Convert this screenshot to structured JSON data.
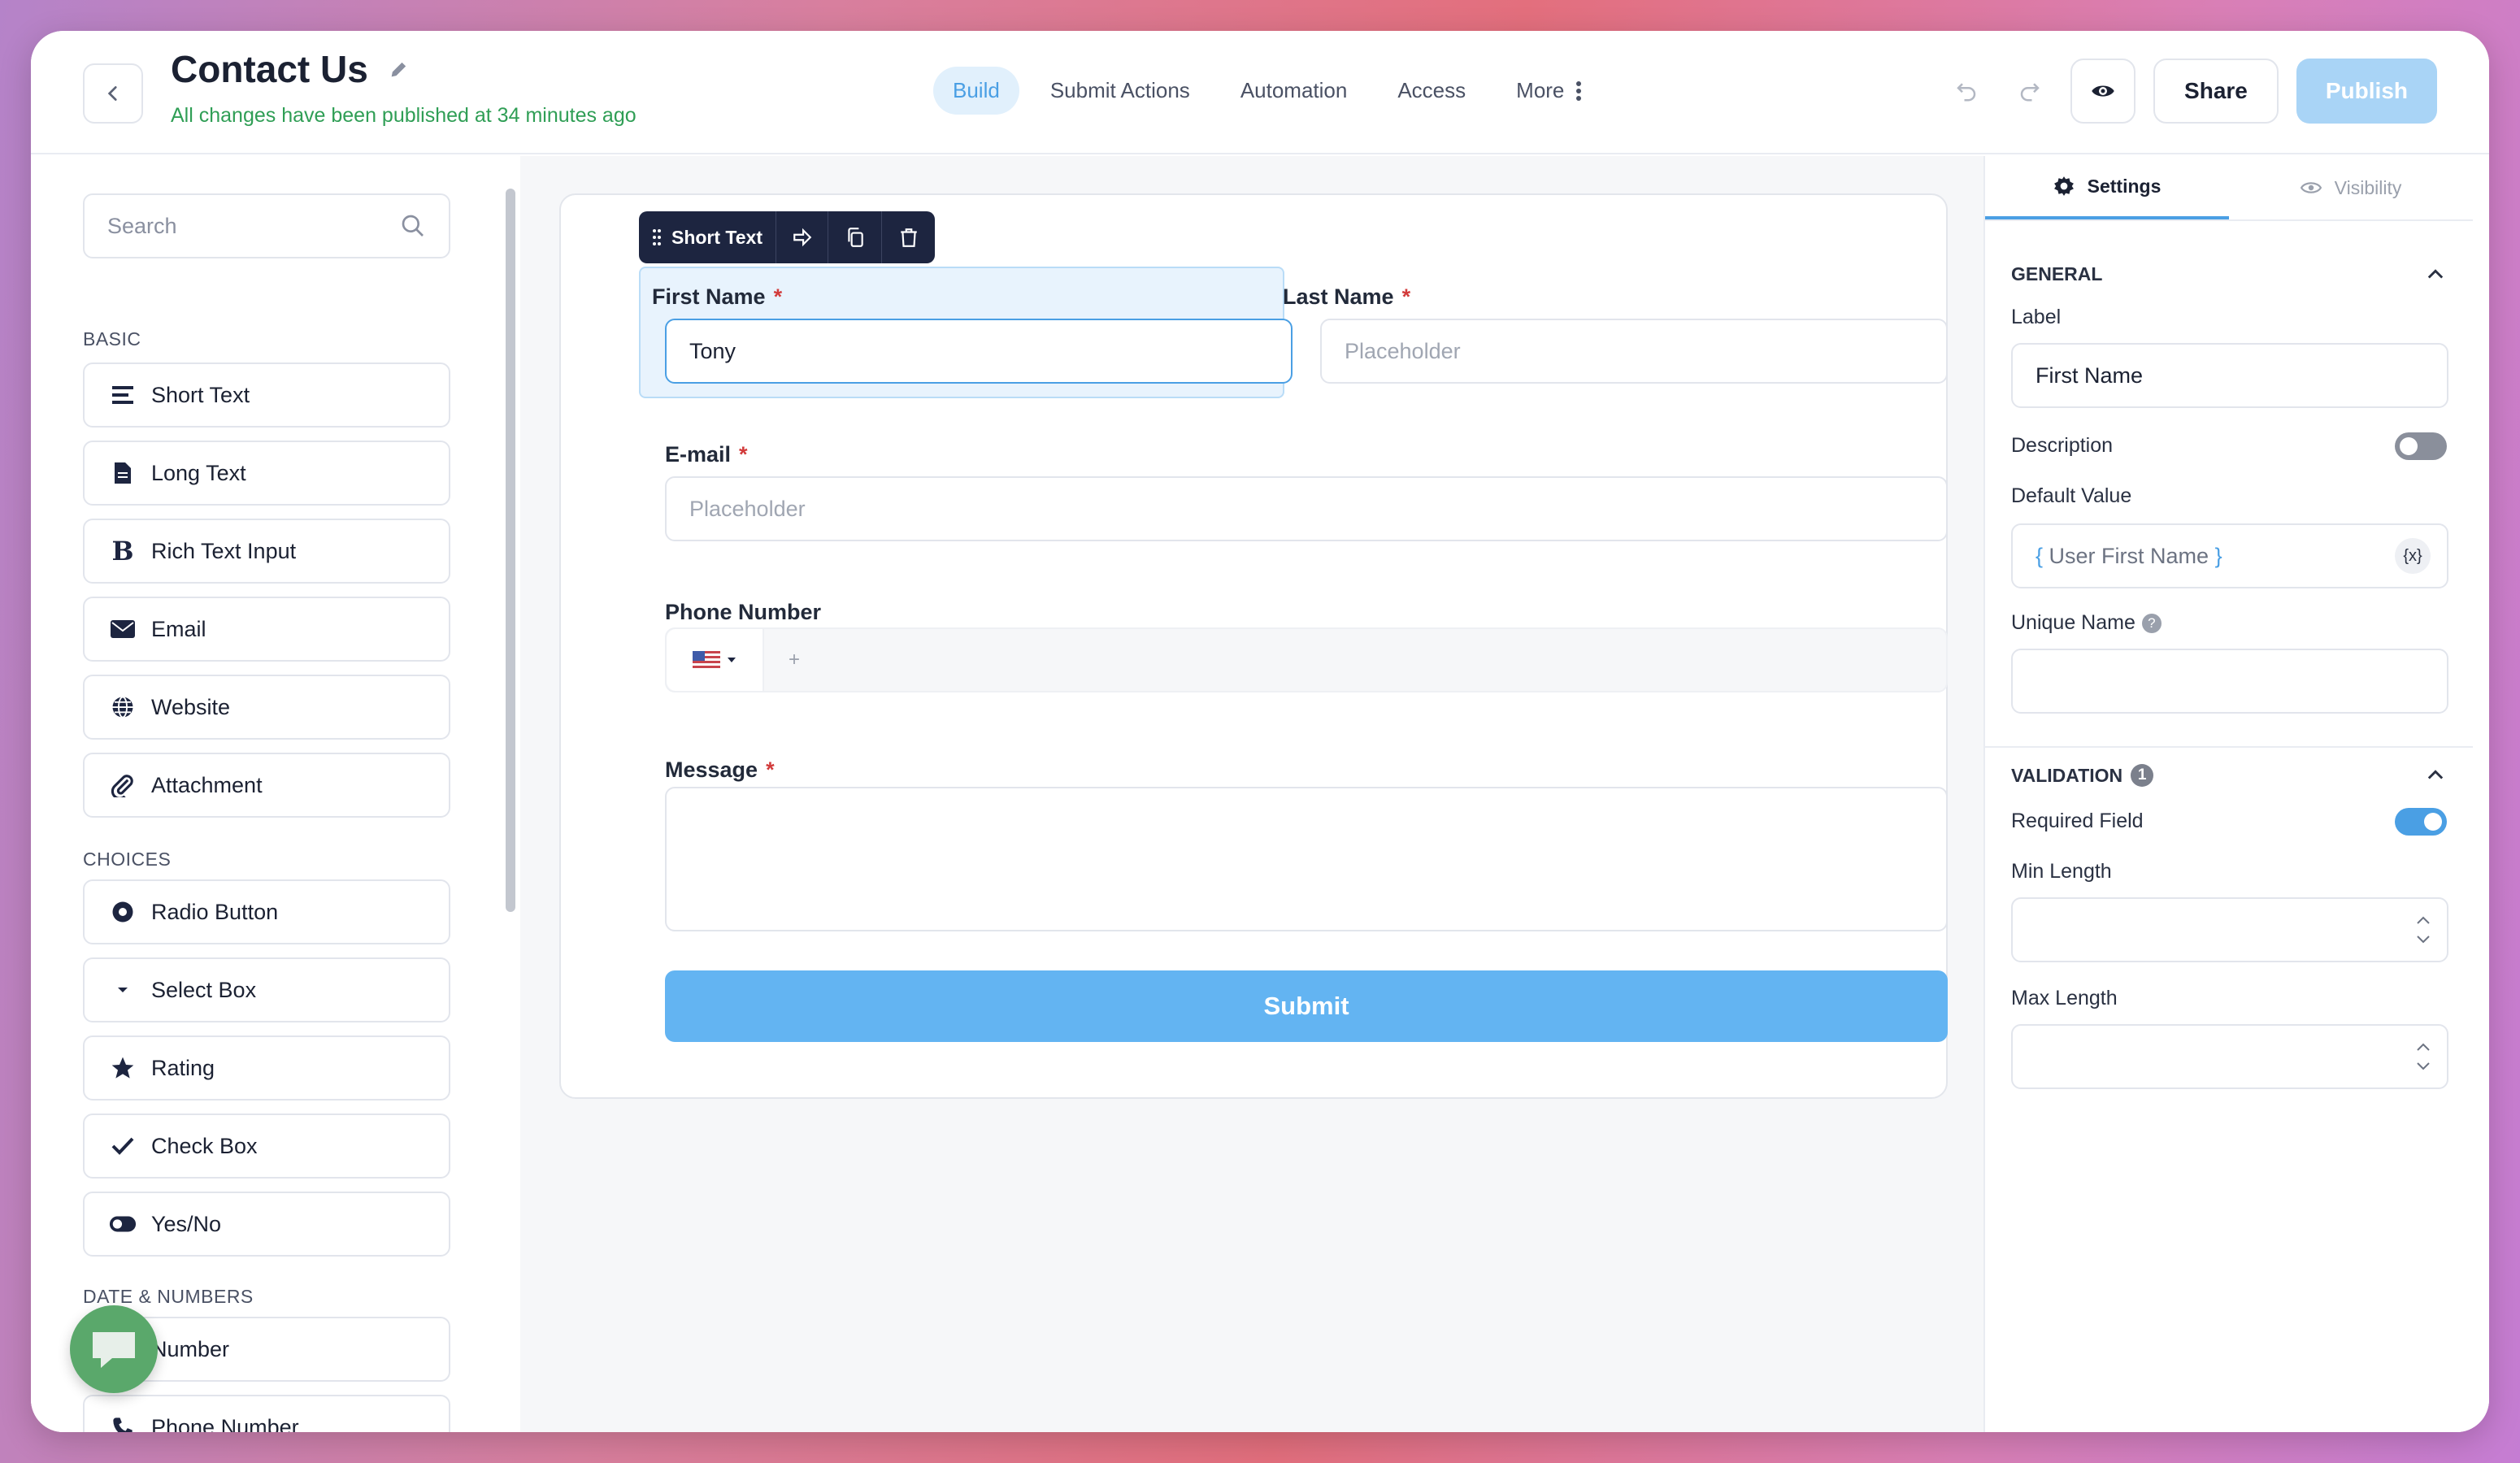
{
  "header": {
    "title": "Contact Us",
    "subtitle": "All changes have been published at 34 minutes ago",
    "tabs": [
      {
        "label": "Build"
      },
      {
        "label": "Submit Actions"
      },
      {
        "label": "Automation"
      },
      {
        "label": "Access"
      },
      {
        "label": "More"
      }
    ],
    "share_label": "Share",
    "publish_label": "Publish"
  },
  "sidebar": {
    "search_placeholder": "Search",
    "sections": {
      "basic": "BASIC",
      "choices": "CHOICES",
      "date_numbers": "DATE & NUMBERS"
    },
    "basic_items": [
      {
        "label": "Short Text",
        "icon": "short-text-icon"
      },
      {
        "label": "Long Text",
        "icon": "document-icon"
      },
      {
        "label": "Rich Text Input",
        "icon": "bold-icon"
      },
      {
        "label": "Email",
        "icon": "envelope-icon"
      },
      {
        "label": "Website",
        "icon": "globe-icon"
      },
      {
        "label": "Attachment",
        "icon": "paperclip-icon"
      }
    ],
    "choice_items": [
      {
        "label": "Radio Button",
        "icon": "radio-icon"
      },
      {
        "label": "Select Box",
        "icon": "caret-down-icon"
      },
      {
        "label": "Rating",
        "icon": "star-icon"
      },
      {
        "label": "Check Box",
        "icon": "check-icon"
      },
      {
        "label": "Yes/No",
        "icon": "toggle-icon"
      }
    ],
    "date_items": [
      {
        "label": "Number",
        "icon": "number-icon"
      },
      {
        "label": "Phone Number",
        "icon": "phone-icon"
      }
    ]
  },
  "form": {
    "toolbar_label": "Short Text",
    "first_name": {
      "label": "First Name",
      "value": "Tony"
    },
    "last_name": {
      "label": "Last Name",
      "placeholder": "Placeholder"
    },
    "email": {
      "label": "E-mail",
      "placeholder": "Placeholder"
    },
    "phone": {
      "label": "Phone Number",
      "prefix": "+"
    },
    "message": {
      "label": "Message"
    },
    "required_marker": "*",
    "submit_label": "Submit"
  },
  "settings": {
    "tabs": [
      {
        "label": "Settings"
      },
      {
        "label": "Visibility"
      }
    ],
    "general": {
      "heading": "GENERAL",
      "label_label": "Label",
      "label_value": "First Name",
      "description_label": "Description",
      "description_enabled": false,
      "default_value_label": "Default Value",
      "default_value": "User First Name",
      "default_value_open": "{",
      "default_value_close": "}",
      "variable_button": "{x}",
      "unique_name_label": "Unique Name",
      "unique_name_help": "?"
    },
    "validation": {
      "heading": "VALIDATION",
      "count": "1",
      "required_label": "Required Field",
      "required_enabled": true,
      "min_length_label": "Min Length",
      "max_length_label": "Max Length"
    }
  },
  "colors": {
    "accent": "#4a9fe4",
    "submit": "#63b4f2",
    "success_text": "#2f9e55",
    "required": "#d23b3b",
    "toolbar_bg": "#1d2540"
  }
}
